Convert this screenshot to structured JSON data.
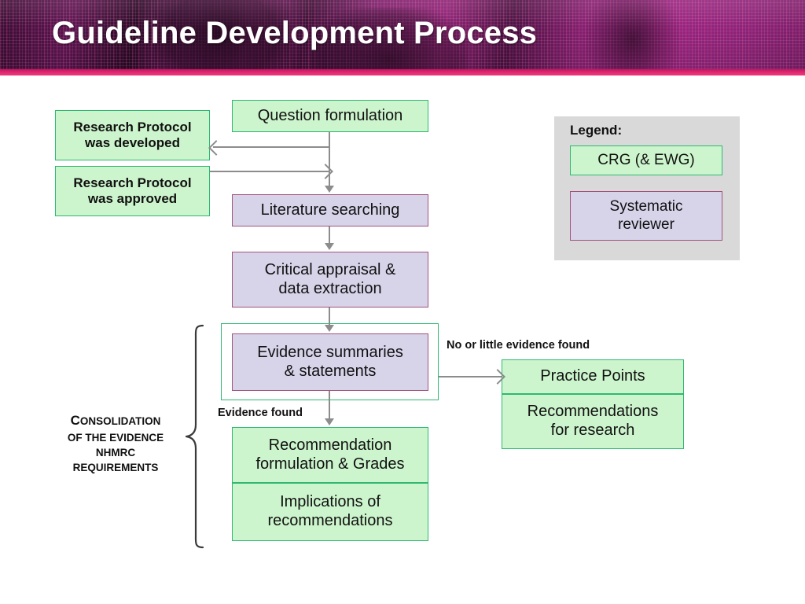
{
  "header": {
    "title": "Guideline Development Process",
    "accent_stripe_color": "#e0246e",
    "background_color": "#7a1d68"
  },
  "palette": {
    "green_fill": "#cdf5cd",
    "green_border": "#2eb872",
    "purple_fill": "#d7d4ea",
    "purple_border": "#a4527c",
    "connector": "#8c8c8c",
    "legend_panel": "#d9d9d9"
  },
  "flow": {
    "question_formulation": "Question formulation",
    "research_protocol_developed": "Research Protocol\nwas developed",
    "research_protocol_developed_line1": "Research Protocol",
    "research_protocol_developed_line2": "was developed",
    "research_protocol_approved_line1": "Research Protocol",
    "research_protocol_approved_line2": "was approved",
    "literature_searching": "Literature searching",
    "critical_appraisal_line1": "Critical appraisal &",
    "critical_appraisal_line2": "data extraction",
    "evidence_summaries_line1": "Evidence summaries",
    "evidence_summaries_line2": "& statements",
    "recommendation_formulation_line1": "Recommendation",
    "recommendation_formulation_line2": "formulation & Grades",
    "implications_line1": "Implications of",
    "implications_line2": "recommendations",
    "practice_points": "Practice Points",
    "recommendations_research_line1": "Recommendations",
    "recommendations_research_line2": "for research"
  },
  "edge_labels": {
    "no_or_little_evidence": "No or little evidence found",
    "evidence_found": "Evidence found"
  },
  "consolidation": {
    "line1_cap": "C",
    "line1_rest": "ONSOLIDATION",
    "line2": "OF THE EVIDENCE",
    "line3": "NHMRC",
    "line4": "REQUIREMENTS"
  },
  "legend": {
    "title": "Legend:",
    "crg": "CRG (& EWG)",
    "systematic_reviewer_line1": "Systematic",
    "systematic_reviewer_line2": "reviewer"
  }
}
